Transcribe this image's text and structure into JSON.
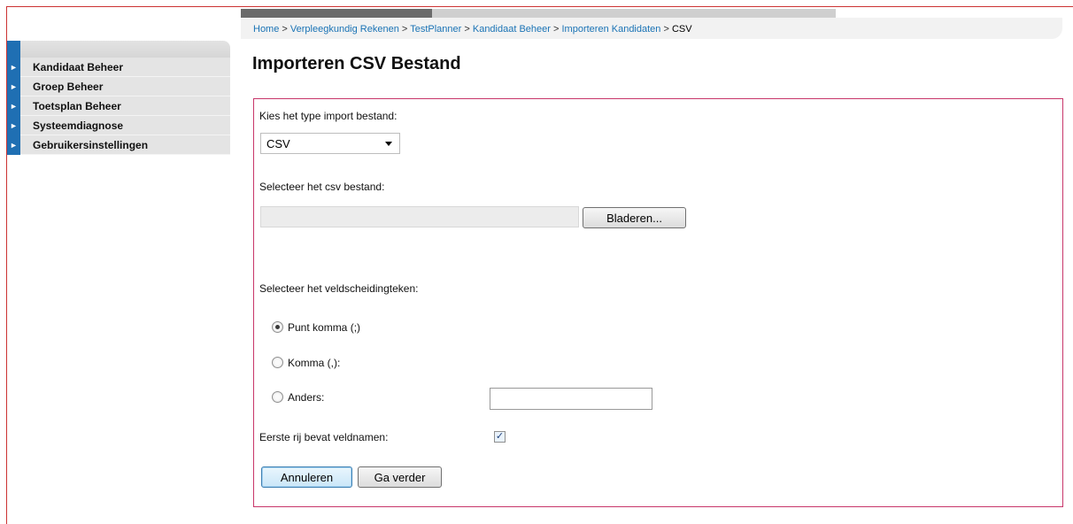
{
  "breadcrumb": {
    "home": "Home",
    "sep": ">",
    "item1": "Verpleegkundig Rekenen",
    "item2": "TestPlanner",
    "item3": "Kandidaat Beheer",
    "item4": "Importeren Kandidaten",
    "current": "CSV"
  },
  "sidebar": {
    "arrow_glyph": "►",
    "items": [
      {
        "label": "Kandidaat Beheer"
      },
      {
        "label": "Groep Beheer"
      },
      {
        "label": "Toetsplan Beheer"
      },
      {
        "label": "Systeemdiagnose"
      },
      {
        "label": "Gebruikersinstellingen"
      }
    ]
  },
  "page": {
    "title": "Importeren CSV Bestand"
  },
  "form": {
    "type_label": "Kies het type import bestand:",
    "type_value": "CSV",
    "file_label": "Selecteer het csv bestand:",
    "browse_label": "Bladeren...",
    "delimiter_label": "Selecteer het veldscheidingteken:",
    "options": [
      {
        "label": "Punt komma (;)",
        "checked": true
      },
      {
        "label": "Komma (,):",
        "checked": false
      },
      {
        "label": "Anders:",
        "checked": false
      }
    ],
    "other_value": "",
    "header_label": "Eerste rij bevat veldnamen:",
    "header_checked": true,
    "check_glyph": "✓",
    "cancel_label": "Annuleren",
    "next_label": "Ga verder"
  },
  "colors": {
    "accent_blue": "#1f6fb3",
    "link": "#1a73b5",
    "panel_border": "#c8366a",
    "frame_red": "#cc3333"
  }
}
